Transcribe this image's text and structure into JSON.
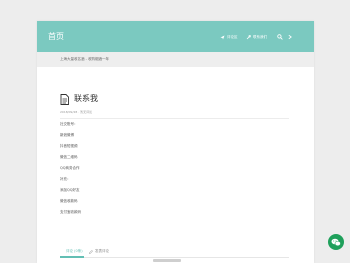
{
  "header": {
    "site_title": "首页",
    "nav": [
      {
        "label": "评论区",
        "icon": "send-icon"
      },
      {
        "label": "联系我们",
        "icon": "link-icon"
      }
    ],
    "search_icon": "search-icon",
    "login_icon": "login-icon"
  },
  "breadcrumb": "上海大量收名酒 - 收购烟酒一年",
  "page": {
    "title": "联系我",
    "title_icon": "document-icon",
    "meta": "2018/09/28 · 暂无评论"
  },
  "content": {
    "lines": [
      "社交账号：",
      "新浪微博",
      "抖音短视频",
      "微信二维码",
      "QQ商务合作",
      "补充：",
      "添加QQ好友",
      "微信收款码",
      "支付宝收款码"
    ]
  },
  "tabs": {
    "active": "评论 (0条)",
    "inactive": "发表评论"
  },
  "colors": {
    "accent": "#7bc9c0",
    "wechat": "#1fa05b"
  }
}
